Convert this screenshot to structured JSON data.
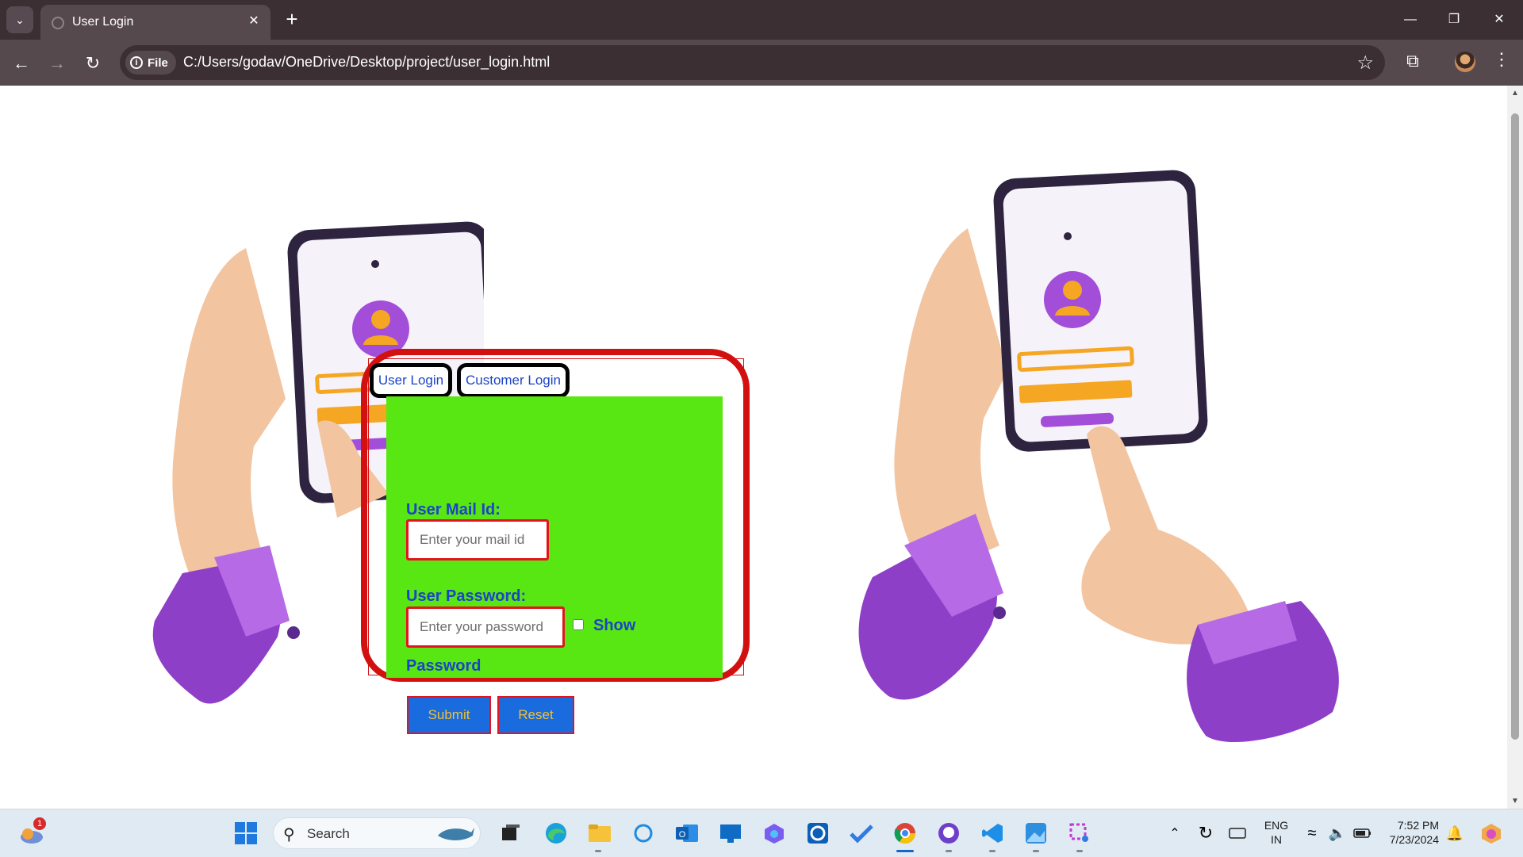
{
  "browser": {
    "tab_title": "User Login",
    "site_chip": "File",
    "url": "C:/Users/godav/OneDrive/Desktop/project/user_login.html"
  },
  "login": {
    "tabs": [
      "User Login",
      "Customer Login"
    ],
    "mail_label": "User Mail Id:",
    "mail_placeholder": "Enter your mail id",
    "password_label": "User Password:",
    "password_placeholder": "Enter your password",
    "show_label": "Show",
    "show_label_wrap": "Password",
    "submit_label": "Submit",
    "reset_label": "Reset",
    "colors": {
      "panel": "#58e712",
      "frame": "#d21010",
      "label": "#1c43c8",
      "button": "#1a6bde",
      "button_text": "#f2c12e"
    }
  },
  "taskbar": {
    "weather_badge": "1",
    "search_placeholder": "Search",
    "lang_line1": "ENG",
    "lang_line2": "IN",
    "time": "7:52 PM",
    "date": "7/23/2024"
  },
  "icons": {
    "illustrations": [
      "hand-holding-phone-left",
      "hand-holding-phone-right"
    ],
    "taskbar": [
      "weather-icon",
      "windows-start-icon",
      "search-icon",
      "whale-search-highlight-icon",
      "task-view-icon",
      "edge-icon",
      "file-explorer-icon",
      "cortana-icon",
      "outlook-icon",
      "remote-desktop-icon",
      "copilot-icon",
      "cortana-blue-icon",
      "todo-icon",
      "chrome-icon",
      "github-desktop-icon",
      "vscode-icon",
      "photos-icon",
      "snipping-tool-icon"
    ]
  }
}
